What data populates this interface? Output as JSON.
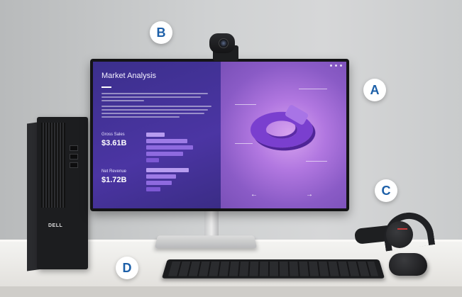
{
  "badges": {
    "a": "A",
    "b": "B",
    "c": "C",
    "d": "D"
  },
  "screen": {
    "title": "Market Analysis",
    "metrics": [
      {
        "label": "Gross Sales",
        "value": "$3.61B"
      },
      {
        "label": "Net Revenue",
        "value": "$1.72B"
      }
    ]
  },
  "tower": {
    "logo": "DELL"
  },
  "colors": {
    "badge_text": "#1c5fa8",
    "screen_left": "#4b35a3",
    "screen_right": "#b177e0"
  }
}
